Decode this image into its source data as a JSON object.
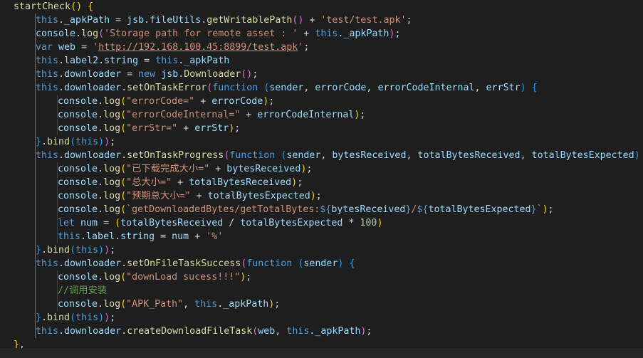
{
  "editor": {
    "language": "javascript",
    "theme": "Dark+",
    "lines": [
      {
        "indent": 0,
        "tokens": [
          [
            "fn",
            "startCheck"
          ],
          [
            "p1",
            "()"
          ],
          [
            "plain",
            " "
          ],
          [
            "p1",
            "{"
          ]
        ]
      },
      {
        "indent": 1,
        "tokens": [
          [
            "kw",
            "this"
          ],
          [
            "plain",
            "."
          ],
          [
            "var",
            "_apkPath"
          ],
          [
            "plain",
            " = "
          ],
          [
            "var",
            "jsb"
          ],
          [
            "plain",
            "."
          ],
          [
            "var",
            "fileUtils"
          ],
          [
            "plain",
            "."
          ],
          [
            "fn",
            "getWritablePath"
          ],
          [
            "p2",
            "()"
          ],
          [
            "plain",
            " + "
          ],
          [
            "str",
            "'test/test.apk'"
          ],
          [
            "plain",
            ";"
          ]
        ]
      },
      {
        "indent": 1,
        "tokens": [
          [
            "var",
            "console"
          ],
          [
            "plain",
            "."
          ],
          [
            "fn",
            "log"
          ],
          [
            "p2",
            "("
          ],
          [
            "str",
            "'Storage path for remote asset : '"
          ],
          [
            "plain",
            " + "
          ],
          [
            "kw",
            "this"
          ],
          [
            "plain",
            "."
          ],
          [
            "var",
            "_apkPath"
          ],
          [
            "p2",
            ")"
          ],
          [
            "plain",
            ";"
          ]
        ]
      },
      {
        "indent": 1,
        "tokens": [
          [
            "kw",
            "var"
          ],
          [
            "plain",
            " "
          ],
          [
            "var",
            "web"
          ],
          [
            "plain",
            " = "
          ],
          [
            "str",
            "'"
          ],
          [
            "url",
            "http://192.168.100.45:8899/test.apk"
          ],
          [
            "str",
            "'"
          ],
          [
            "plain",
            ";"
          ]
        ]
      },
      {
        "indent": 1,
        "tokens": [
          [
            "kw",
            "this"
          ],
          [
            "plain",
            "."
          ],
          [
            "var",
            "label2"
          ],
          [
            "plain",
            "."
          ],
          [
            "var",
            "string"
          ],
          [
            "plain",
            " = "
          ],
          [
            "kw",
            "this"
          ],
          [
            "plain",
            "."
          ],
          [
            "var",
            "_apkPath"
          ]
        ]
      },
      {
        "indent": 1,
        "tokens": [
          [
            "kw",
            "this"
          ],
          [
            "plain",
            "."
          ],
          [
            "var",
            "downloader"
          ],
          [
            "plain",
            " = "
          ],
          [
            "kw",
            "new"
          ],
          [
            "plain",
            " "
          ],
          [
            "var",
            "jsb"
          ],
          [
            "plain",
            "."
          ],
          [
            "fn",
            "Downloader"
          ],
          [
            "p2",
            "()"
          ],
          [
            "plain",
            ";"
          ]
        ]
      },
      {
        "indent": 1,
        "tokens": [
          [
            "kw",
            "this"
          ],
          [
            "plain",
            "."
          ],
          [
            "var",
            "downloader"
          ],
          [
            "plain",
            "."
          ],
          [
            "fn",
            "setOnTaskError"
          ],
          [
            "p2",
            "("
          ],
          [
            "kw",
            "function"
          ],
          [
            "plain",
            " "
          ],
          [
            "p3",
            "("
          ],
          [
            "var",
            "sender"
          ],
          [
            "plain",
            ", "
          ],
          [
            "var",
            "errorCode"
          ],
          [
            "plain",
            ", "
          ],
          [
            "var",
            "errorCodeInternal"
          ],
          [
            "plain",
            ", "
          ],
          [
            "var",
            "errStr"
          ],
          [
            "p3",
            ")"
          ],
          [
            "plain",
            " "
          ],
          [
            "p3",
            "{"
          ]
        ]
      },
      {
        "indent": 2,
        "tokens": [
          [
            "var",
            "console"
          ],
          [
            "plain",
            "."
          ],
          [
            "fn",
            "log"
          ],
          [
            "p1",
            "("
          ],
          [
            "str",
            "\"errorCode=\""
          ],
          [
            "plain",
            " + "
          ],
          [
            "var",
            "errorCode"
          ],
          [
            "p1",
            ")"
          ],
          [
            "plain",
            ";"
          ]
        ]
      },
      {
        "indent": 2,
        "tokens": [
          [
            "var",
            "console"
          ],
          [
            "plain",
            "."
          ],
          [
            "fn",
            "log"
          ],
          [
            "p1",
            "("
          ],
          [
            "str",
            "\"errorCodeInternal=\""
          ],
          [
            "plain",
            " + "
          ],
          [
            "var",
            "errorCodeInternal"
          ],
          [
            "p1",
            ")"
          ],
          [
            "plain",
            ";"
          ]
        ]
      },
      {
        "indent": 2,
        "tokens": [
          [
            "var",
            "console"
          ],
          [
            "plain",
            "."
          ],
          [
            "fn",
            "log"
          ],
          [
            "p1",
            "("
          ],
          [
            "str",
            "\"errStr=\""
          ],
          [
            "plain",
            " + "
          ],
          [
            "var",
            "errStr"
          ],
          [
            "p1",
            ")"
          ],
          [
            "plain",
            ";"
          ]
        ]
      },
      {
        "indent": 1,
        "tokens": [
          [
            "p3",
            "}"
          ],
          [
            "plain",
            "."
          ],
          [
            "fn",
            "bind"
          ],
          [
            "p3",
            "("
          ],
          [
            "kw",
            "this"
          ],
          [
            "p3",
            ")"
          ],
          [
            "p2",
            ")"
          ],
          [
            "plain",
            ";"
          ]
        ]
      },
      {
        "indent": 1,
        "tokens": [
          [
            "kw",
            "this"
          ],
          [
            "plain",
            "."
          ],
          [
            "var",
            "downloader"
          ],
          [
            "plain",
            "."
          ],
          [
            "fn",
            "setOnTaskProgress"
          ],
          [
            "p2",
            "("
          ],
          [
            "kw",
            "function"
          ],
          [
            "plain",
            " "
          ],
          [
            "p3",
            "("
          ],
          [
            "var",
            "sender"
          ],
          [
            "plain",
            ", "
          ],
          [
            "var",
            "bytesReceived"
          ],
          [
            "plain",
            ", "
          ],
          [
            "var",
            "totalBytesReceived"
          ],
          [
            "plain",
            ", "
          ],
          [
            "var",
            "totalBytesExpected"
          ],
          [
            "p3",
            ")"
          ],
          [
            "plain",
            " "
          ],
          [
            "p3",
            "{"
          ]
        ]
      },
      {
        "indent": 2,
        "tokens": [
          [
            "var",
            "console"
          ],
          [
            "plain",
            "."
          ],
          [
            "fn",
            "log"
          ],
          [
            "p1",
            "("
          ],
          [
            "str",
            "\"已下载完成大小=\""
          ],
          [
            "plain",
            " + "
          ],
          [
            "var",
            "bytesReceived"
          ],
          [
            "p1",
            ")"
          ],
          [
            "plain",
            ";"
          ]
        ]
      },
      {
        "indent": 2,
        "tokens": [
          [
            "var",
            "console"
          ],
          [
            "plain",
            "."
          ],
          [
            "fn",
            "log"
          ],
          [
            "p1",
            "("
          ],
          [
            "str",
            "\"总大小=\""
          ],
          [
            "plain",
            " + "
          ],
          [
            "var",
            "totalBytesReceived"
          ],
          [
            "p1",
            ")"
          ],
          [
            "plain",
            ";"
          ]
        ]
      },
      {
        "indent": 2,
        "tokens": [
          [
            "var",
            "console"
          ],
          [
            "plain",
            "."
          ],
          [
            "fn",
            "log"
          ],
          [
            "p1",
            "("
          ],
          [
            "str",
            "\"预期总大小=\""
          ],
          [
            "plain",
            " + "
          ],
          [
            "var",
            "totalBytesExpected"
          ],
          [
            "p1",
            ")"
          ],
          [
            "plain",
            ";"
          ]
        ]
      },
      {
        "indent": 2,
        "tokens": [
          [
            "var",
            "console"
          ],
          [
            "plain",
            "."
          ],
          [
            "fn",
            "log"
          ],
          [
            "p1",
            "("
          ],
          [
            "str",
            "`getDownloadedBytes/getTotalBytes:"
          ],
          [
            "kw",
            "${"
          ],
          [
            "var",
            "bytesReceived"
          ],
          [
            "kw",
            "}"
          ],
          [
            "str",
            "/"
          ],
          [
            "kw",
            "${"
          ],
          [
            "var",
            "totalBytesExpected"
          ],
          [
            "kw",
            "}"
          ],
          [
            "str",
            "`"
          ],
          [
            "p1",
            ")"
          ],
          [
            "plain",
            ";"
          ]
        ]
      },
      {
        "indent": 2,
        "tokens": [
          [
            "kw",
            "let"
          ],
          [
            "plain",
            " "
          ],
          [
            "var",
            "num"
          ],
          [
            "plain",
            " = "
          ],
          [
            "p1",
            "("
          ],
          [
            "var",
            "totalBytesReceived"
          ],
          [
            "plain",
            " / "
          ],
          [
            "var",
            "totalBytesExpected"
          ],
          [
            "plain",
            " * "
          ],
          [
            "num",
            "100"
          ],
          [
            "p1",
            ")"
          ]
        ]
      },
      {
        "indent": 2,
        "tokens": [
          [
            "kw",
            "this"
          ],
          [
            "plain",
            "."
          ],
          [
            "var",
            "label"
          ],
          [
            "plain",
            "."
          ],
          [
            "var",
            "string"
          ],
          [
            "plain",
            " = "
          ],
          [
            "var",
            "num"
          ],
          [
            "plain",
            " + "
          ],
          [
            "str",
            "'%'"
          ]
        ]
      },
      {
        "indent": 1,
        "tokens": [
          [
            "p3",
            "}"
          ],
          [
            "plain",
            "."
          ],
          [
            "fn",
            "bind"
          ],
          [
            "p3",
            "("
          ],
          [
            "kw",
            "this"
          ],
          [
            "p3",
            ")"
          ],
          [
            "p2",
            ")"
          ],
          [
            "plain",
            ";"
          ]
        ]
      },
      {
        "indent": 1,
        "tokens": [
          [
            "kw",
            "this"
          ],
          [
            "plain",
            "."
          ],
          [
            "var",
            "downloader"
          ],
          [
            "plain",
            "."
          ],
          [
            "fn",
            "setOnFileTaskSuccess"
          ],
          [
            "p2",
            "("
          ],
          [
            "kw",
            "function"
          ],
          [
            "plain",
            " "
          ],
          [
            "p3",
            "("
          ],
          [
            "var",
            "sender"
          ],
          [
            "p3",
            ")"
          ],
          [
            "plain",
            " "
          ],
          [
            "p3",
            "{"
          ]
        ]
      },
      {
        "indent": 2,
        "tokens": [
          [
            "var",
            "console"
          ],
          [
            "plain",
            "."
          ],
          [
            "fn",
            "log"
          ],
          [
            "p1",
            "("
          ],
          [
            "str",
            "\"downLoad sucess!!!\""
          ],
          [
            "p1",
            ")"
          ],
          [
            "plain",
            ";"
          ]
        ]
      },
      {
        "indent": 2,
        "tokens": [
          [
            "cmt",
            "//调用安装"
          ]
        ]
      },
      {
        "indent": 2,
        "tokens": [
          [
            "var",
            "console"
          ],
          [
            "plain",
            "."
          ],
          [
            "fn",
            "log"
          ],
          [
            "p1",
            "("
          ],
          [
            "str",
            "\"APK_Path\""
          ],
          [
            "plain",
            ", "
          ],
          [
            "kw",
            "this"
          ],
          [
            "plain",
            "."
          ],
          [
            "var",
            "_apkPath"
          ],
          [
            "p1",
            ")"
          ],
          [
            "plain",
            ";"
          ]
        ]
      },
      {
        "indent": 1,
        "tokens": [
          [
            "p3",
            "}"
          ],
          [
            "plain",
            "."
          ],
          [
            "fn",
            "bind"
          ],
          [
            "p3",
            "("
          ],
          [
            "kw",
            "this"
          ],
          [
            "p3",
            ")"
          ],
          [
            "p2",
            ")"
          ],
          [
            "plain",
            ";"
          ]
        ]
      },
      {
        "indent": 1,
        "tokens": [
          [
            "kw",
            "this"
          ],
          [
            "plain",
            "."
          ],
          [
            "var",
            "downloader"
          ],
          [
            "plain",
            "."
          ],
          [
            "fn",
            "createDownloadFileTask"
          ],
          [
            "p2",
            "("
          ],
          [
            "var",
            "web"
          ],
          [
            "plain",
            ", "
          ],
          [
            "kw",
            "this"
          ],
          [
            "plain",
            "."
          ],
          [
            "var",
            "_apkPath"
          ],
          [
            "p2",
            ")"
          ],
          [
            "plain",
            ";"
          ]
        ]
      },
      {
        "indent": 0,
        "tokens": [
          [
            "p1",
            "}"
          ],
          [
            "plain",
            ","
          ]
        ]
      }
    ]
  }
}
